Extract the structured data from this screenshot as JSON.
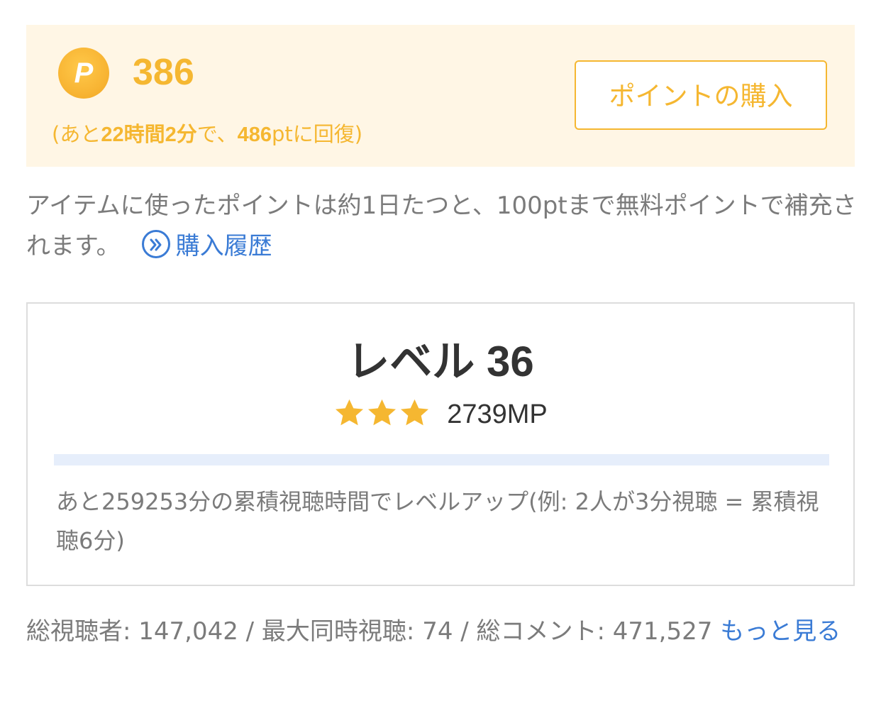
{
  "points": {
    "coin_symbol": "P",
    "value": "386",
    "recovery": {
      "prefix": "(あと",
      "time": "22時間2分",
      "middle": "で、",
      "amount": "486",
      "suffix": "ptに回復)"
    },
    "buy_label": "ポイントの購入"
  },
  "info": {
    "text": "アイテムに使ったポイントは約1日たつと、100ptまで無料ポイントで補充されます。",
    "history_link": "購入履歴"
  },
  "level": {
    "title": "レベル 36",
    "stars": 3,
    "mp": "2739MP",
    "progress_fraction": 1.0,
    "levelup_text": "あと259253分の累積視聴時間でレベルアップ(例: 2人が3分視聴 = 累積視聴6分)"
  },
  "stats": {
    "text": "総視聴者: 147,042 / 最大同時視聴: 74 / 総コメント: 471,527 ",
    "more_link": "もっと見る"
  },
  "colors": {
    "accent_orange": "#f5b731",
    "panel_bg": "#fff6e5",
    "link_blue": "#3a7bd5",
    "progress_track": "#e6eefb"
  }
}
